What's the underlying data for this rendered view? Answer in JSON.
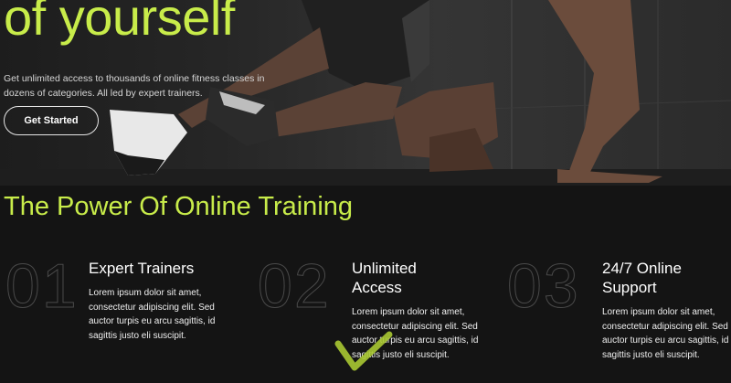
{
  "hero": {
    "title": "of yourself",
    "description": "Get unlimited access to thousands of online fitness classes in dozens of categories. All led by expert trainers.",
    "cta_label": "Get Started"
  },
  "section": {
    "title": "The Power Of Online Training"
  },
  "features": [
    {
      "number": "01",
      "title": "Expert Trainers",
      "text": "Lorem ipsum dolor sit amet, consectetur adipiscing elit. Sed auctor turpis eu arcu sagittis, id sagittis justo eli suscipit."
    },
    {
      "number": "02",
      "title": "Unlimited Access",
      "text": "Lorem ipsum dolor sit amet, consectetur adipiscing elit. Sed auctor turpis eu arcu sagittis, id sagittis justo eli suscipit."
    },
    {
      "number": "03",
      "title": "24/7 Online Support",
      "text": "Lorem ipsum dolor sit amet, consectetur adipiscing elit. Sed auctor turpis eu arcu sagittis, id sagittis justo eli suscipit."
    }
  ],
  "icons": {
    "hero_image": "athlete-running-photo",
    "overlay": "checkmark-icon"
  },
  "colors": {
    "accent": "#c8ec4a",
    "background": "#141414",
    "hero_background": "#2a2a2a",
    "text": "#ffffff",
    "number_outline": "#4a4a4a"
  }
}
